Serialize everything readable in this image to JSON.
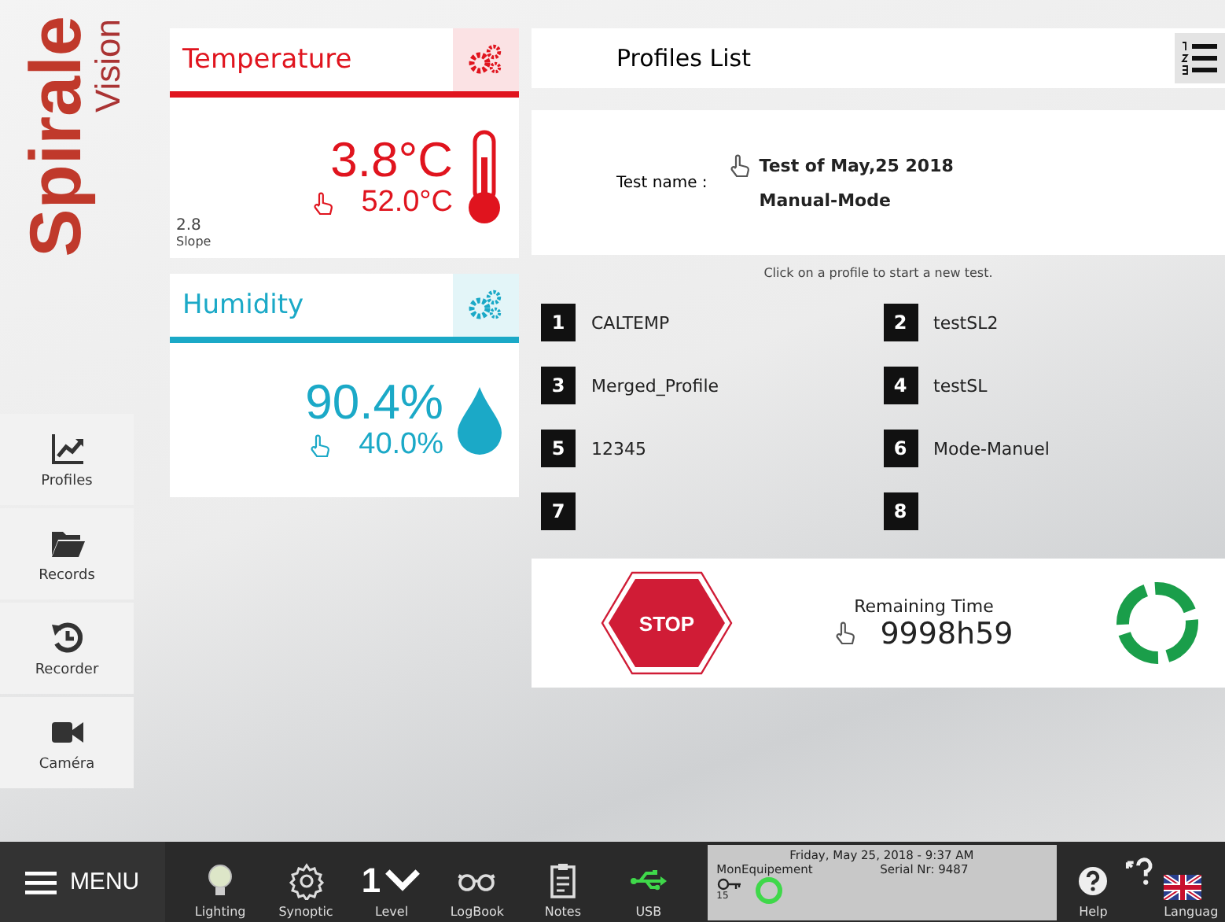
{
  "logo": {
    "name": "Spirale",
    "sub": "Vision"
  },
  "sidebar": {
    "items": [
      {
        "label": "Profiles",
        "kind": "chart"
      },
      {
        "label": "Records",
        "kind": "folder"
      },
      {
        "label": "Recorder",
        "kind": "history"
      },
      {
        "label": "Caméra",
        "kind": "camera"
      }
    ]
  },
  "sensors": [
    {
      "kind": "temperature",
      "title": "Temperature",
      "value": "3.8°C",
      "setpoint": "52.0°C",
      "slope": "2.8",
      "slope_label": "Slope",
      "color": "#e0141e"
    },
    {
      "kind": "humidity",
      "title": "Humidity",
      "value": "90.4%",
      "setpoint": "40.0%",
      "color": "#1ba9c7"
    }
  ],
  "profiles_panel": {
    "title": "Profiles List",
    "test_label": "Test name  :",
    "test_name": "Test of May,25 2018",
    "mode": "Manual-Mode",
    "hint": "Click on a profile to start a new test.",
    "profiles": [
      {
        "number": "1",
        "name": "CALTEMP"
      },
      {
        "number": "2",
        "name": "testSL2"
      },
      {
        "number": "3",
        "name": "Merged_Profile"
      },
      {
        "number": "4",
        "name": "testSL"
      },
      {
        "number": "5",
        "name": "12345"
      },
      {
        "number": "6",
        "name": "Mode-Manuel"
      },
      {
        "number": "7"
      },
      {
        "number": "8"
      }
    ]
  },
  "run": {
    "stop": "STOP",
    "remaining_label": "Remaining Time",
    "remaining": "9998h59"
  },
  "footer": {
    "menu": "MENU",
    "items": [
      {
        "kind": "bulb",
        "label": "Lighting"
      },
      {
        "kind": "gear",
        "label": "Synoptic"
      },
      {
        "kind": "level",
        "label": "Level",
        "value": "1"
      },
      {
        "kind": "glasses",
        "label": "LogBook"
      },
      {
        "kind": "clipboard",
        "label": "Notes"
      },
      {
        "kind": "usb",
        "label": "USB"
      }
    ],
    "status": {
      "datetime": "Friday, May 25, 2018 - 9:37 AM",
      "device": "MonEquipement",
      "serial": "Serial Nr: 9487",
      "key_count": "15"
    },
    "help": "Help",
    "language": "Languag"
  }
}
